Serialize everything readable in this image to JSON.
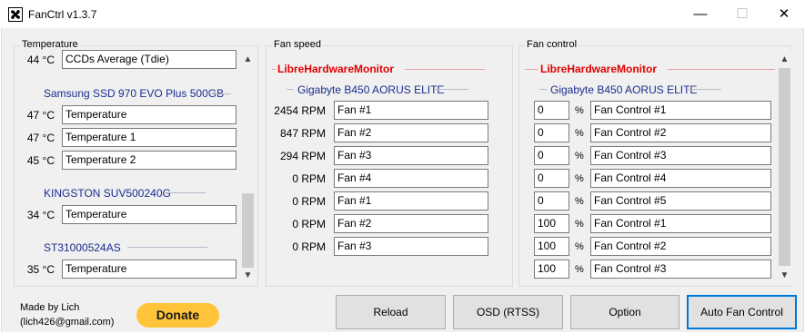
{
  "window": {
    "title": "FanCtrl v1.3.7",
    "minimize": "—",
    "maximize": "☐",
    "close": "✕"
  },
  "temperature": {
    "title": "Temperature",
    "top_row": {
      "value": "44 °C",
      "name": "CCDs Average (Tdie)"
    },
    "devices": [
      {
        "name": "Samsung SSD 970 EVO Plus 500GB",
        "rows": [
          {
            "value": "47 °C",
            "name": "Temperature"
          },
          {
            "value": "47 °C",
            "name": "Temperature 1"
          },
          {
            "value": "45 °C",
            "name": "Temperature 2"
          }
        ]
      },
      {
        "name": "KINGSTON SUV500240G",
        "rows": [
          {
            "value": "34 °C",
            "name": "Temperature"
          }
        ]
      },
      {
        "name": "ST31000524AS",
        "rows": [
          {
            "value": "35 °C",
            "name": "Temperature"
          }
        ]
      }
    ]
  },
  "fan_speed": {
    "title": "Fan speed",
    "source": "LibreHardwareMonitor",
    "device": "Gigabyte B450 AORUS ELITE",
    "rows": [
      {
        "value": "2454 RPM",
        "name": "Fan #1"
      },
      {
        "value": "847 RPM",
        "name": "Fan #2"
      },
      {
        "value": "294 RPM",
        "name": "Fan #3"
      },
      {
        "value": "0 RPM",
        "name": "Fan #4"
      },
      {
        "value": "0 RPM",
        "name": "Fan #1"
      },
      {
        "value": "0 RPM",
        "name": "Fan #2"
      },
      {
        "value": "0 RPM",
        "name": "Fan #3"
      }
    ]
  },
  "fan_control": {
    "title": "Fan control",
    "source": "LibreHardwareMonitor",
    "device": "Gigabyte B450 AORUS ELITE",
    "unit": "%",
    "rows": [
      {
        "value": "0",
        "name": "Fan Control #1"
      },
      {
        "value": "0",
        "name": "Fan Control #2"
      },
      {
        "value": "0",
        "name": "Fan Control #3"
      },
      {
        "value": "0",
        "name": "Fan Control #4"
      },
      {
        "value": "0",
        "name": "Fan Control #5"
      },
      {
        "value": "100",
        "name": "Fan Control #1"
      },
      {
        "value": "100",
        "name": "Fan Control #2"
      },
      {
        "value": "100",
        "name": "Fan Control #3"
      }
    ]
  },
  "footer": {
    "made_by": "Made by Lich",
    "email": "(lich426@gmail.com)",
    "donate": "Donate",
    "reload": "Reload",
    "osd": "OSD (RTSS)",
    "option": "Option",
    "auto": "Auto Fan Control"
  }
}
